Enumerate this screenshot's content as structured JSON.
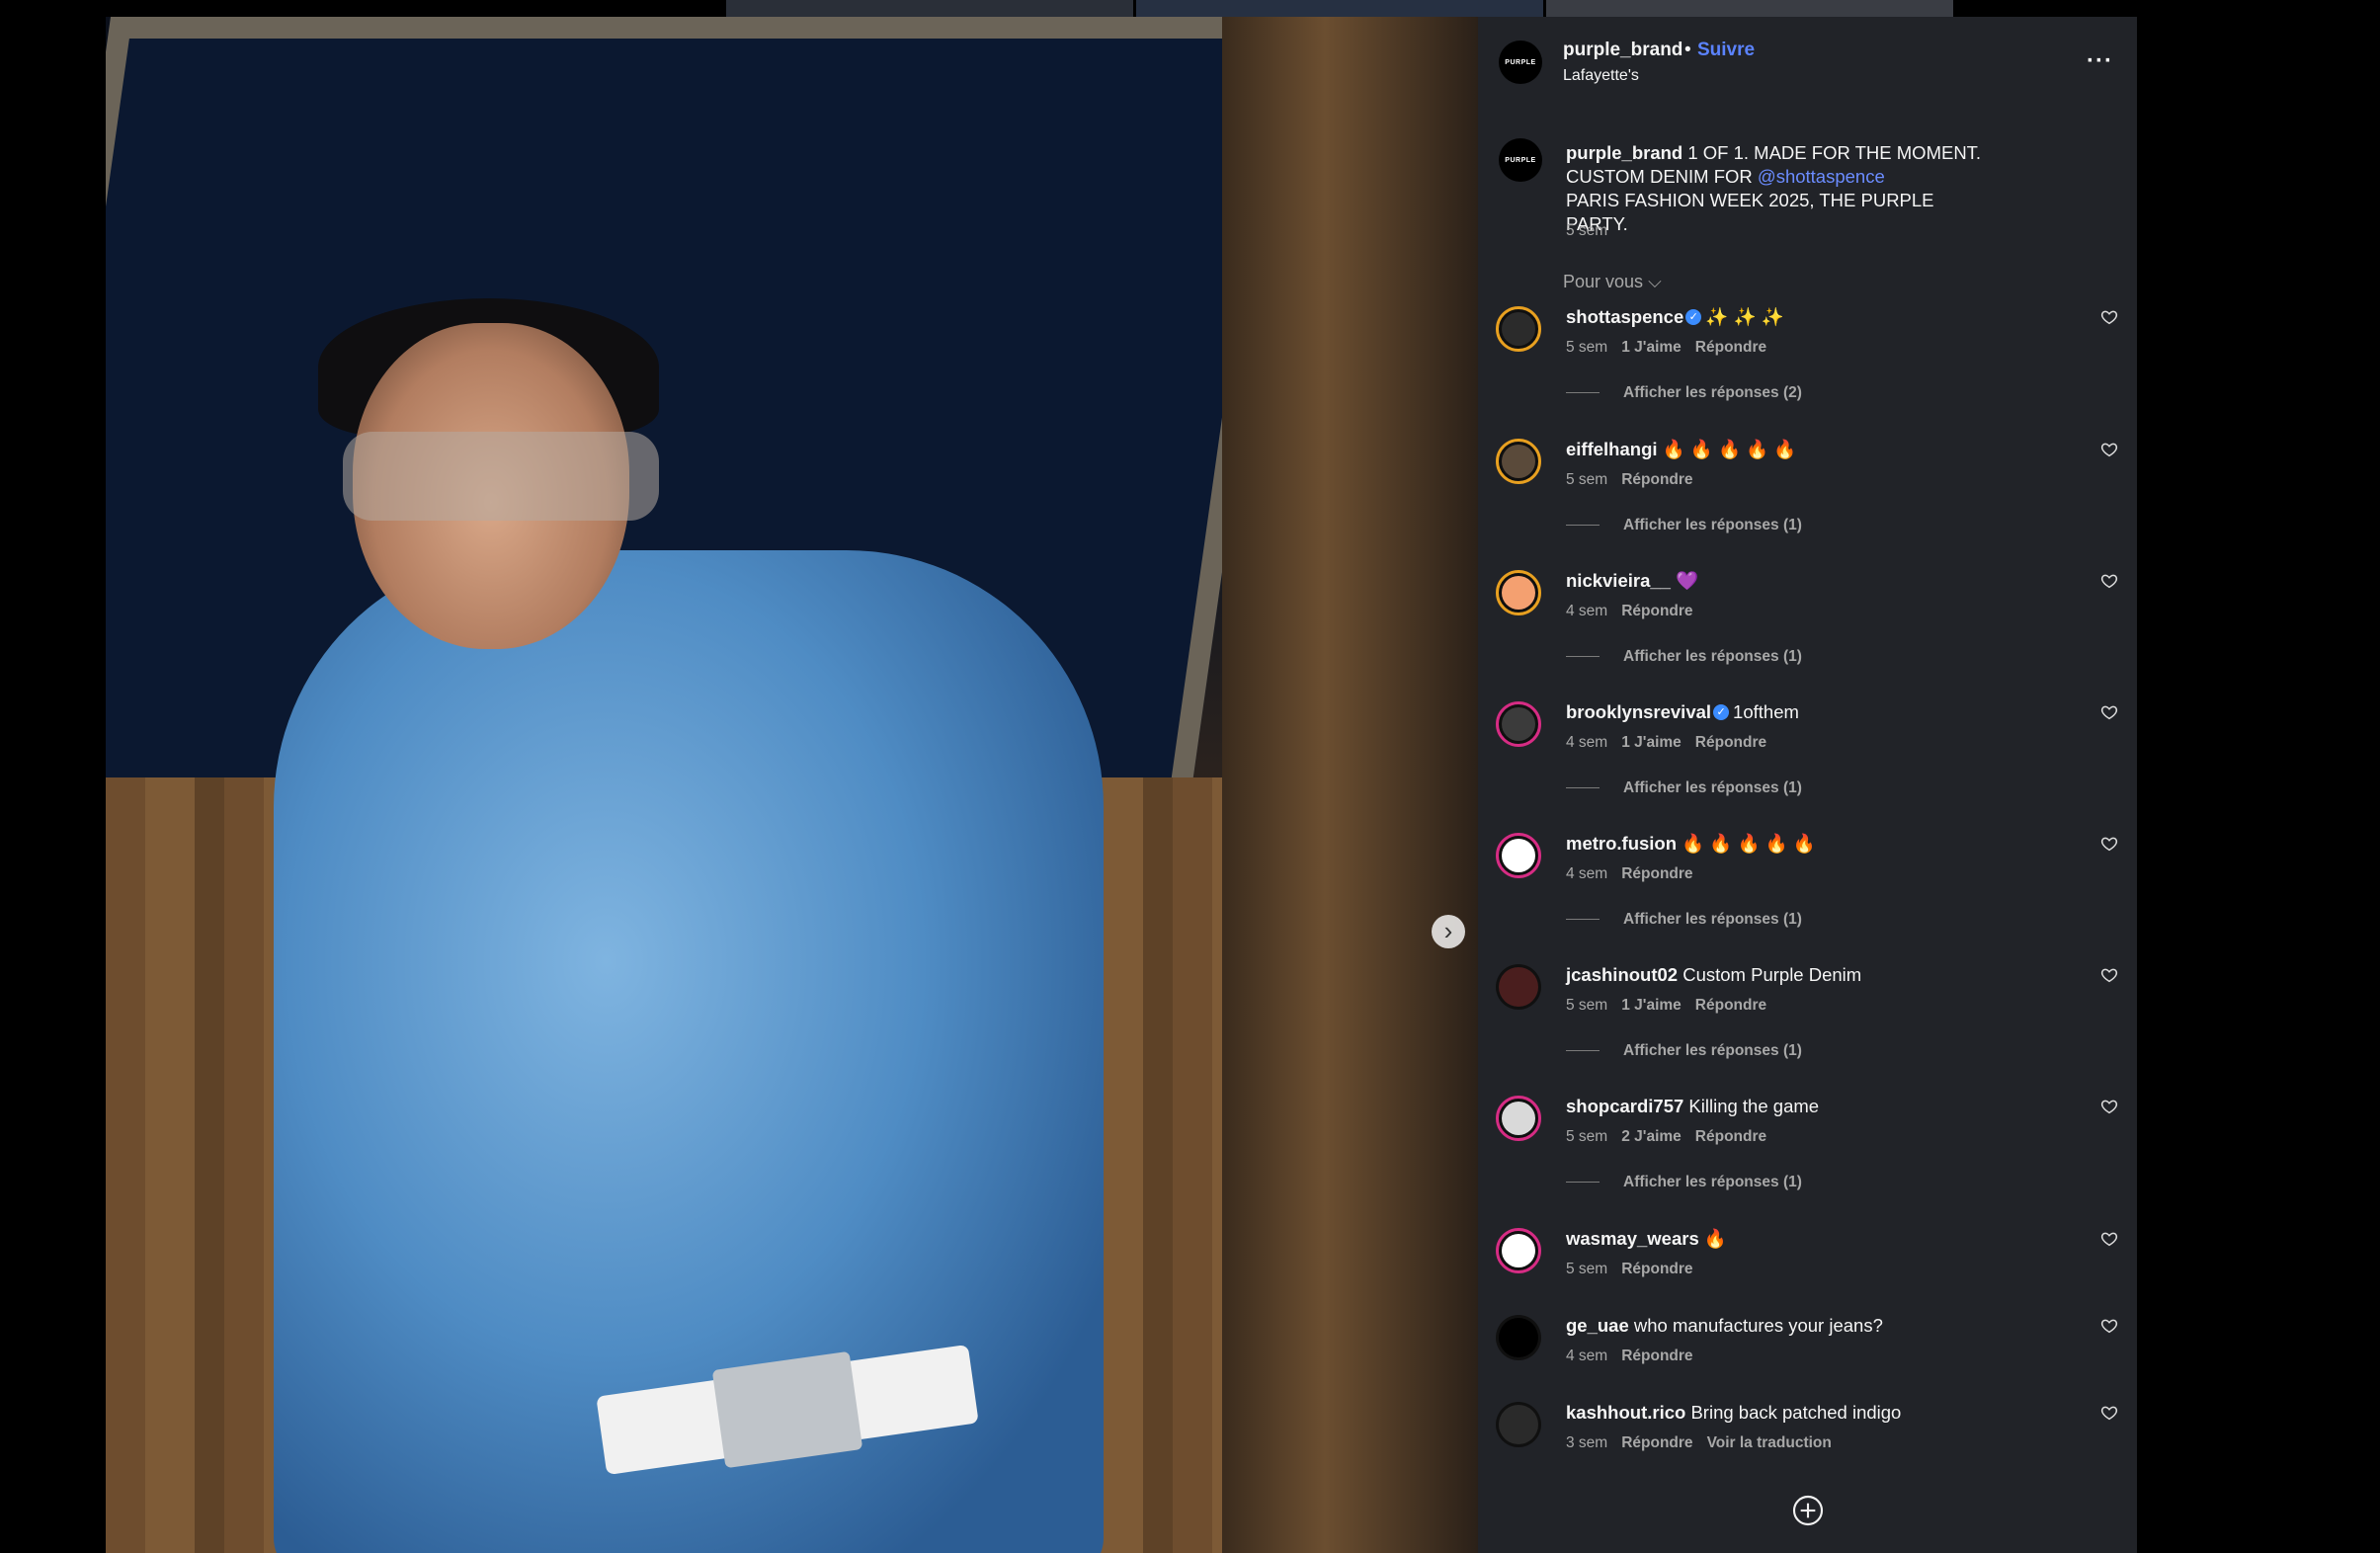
{
  "post": {
    "username": "purple_brand",
    "follow_label": "Suivre",
    "location": "Lafayette's",
    "avatar_text": "PURPLE",
    "caption_user": "purple_brand",
    "caption_line1": " 1 OF 1. MADE FOR THE MOMENT.",
    "caption_line2_prefix": "CUSTOM DENIM FOR ",
    "caption_mention": "@shottaspence",
    "caption_line3": "PARIS FASHION WEEK 2025, THE PURPLE PARTY.",
    "caption_time": "5 sem",
    "filter_label": "Pour vous"
  },
  "comments": [
    {
      "user": "shottaspence",
      "verified": true,
      "text": "✨ ✨ ✨",
      "time": "5 sem",
      "likes": "1 J'aime",
      "reply": "Répondre",
      "replies": "Afficher les réponses (2)",
      "ring": "orange",
      "avatar_color": "#2b2b2b"
    },
    {
      "user": "eiffelhangi",
      "verified": false,
      "text": "🔥 🔥 🔥 🔥 🔥",
      "time": "5 sem",
      "likes": "",
      "reply": "Répondre",
      "replies": "Afficher les réponses (1)",
      "ring": "orange",
      "avatar_color": "#5a4a3a"
    },
    {
      "user": "nickvieira__",
      "verified": false,
      "text": "💜",
      "time": "4 sem",
      "likes": "",
      "reply": "Répondre",
      "replies": "Afficher les réponses (1)",
      "ring": "orange",
      "avatar_color": "#f4a070"
    },
    {
      "user": "brooklynsrevival",
      "verified": true,
      "text": "1ofthem",
      "time": "4 sem",
      "likes": "1 J'aime",
      "reply": "Répondre",
      "replies": "Afficher les réponses (1)",
      "ring": "pink",
      "avatar_color": "#3b3b3b"
    },
    {
      "user": "metro.fusion",
      "verified": false,
      "text": "🔥 🔥 🔥 🔥 🔥",
      "time": "4 sem",
      "likes": "",
      "reply": "Répondre",
      "replies": "Afficher les réponses (1)",
      "ring": "pink",
      "avatar_color": "#ffffff"
    },
    {
      "user": "jcashinout02",
      "verified": false,
      "text": "Custom Purple Denim",
      "time": "5 sem",
      "likes": "1 J'aime",
      "reply": "Répondre",
      "replies": "Afficher les réponses (1)",
      "ring": "none",
      "avatar_color": "#4a1e1e"
    },
    {
      "user": "shopcardi757",
      "verified": false,
      "text": "Killing the game",
      "time": "5 sem",
      "likes": "2 J'aime",
      "reply": "Répondre",
      "replies": "Afficher les réponses (1)",
      "ring": "pink",
      "avatar_color": "#d9d9d9"
    },
    {
      "user": "wasmay_wears",
      "verified": false,
      "text": "🔥",
      "time": "5 sem",
      "likes": "",
      "reply": "Répondre",
      "replies": "",
      "ring": "pink",
      "avatar_color": "#ffffff"
    },
    {
      "user": "ge_uae",
      "verified": false,
      "text": "who manufactures your jeans?",
      "time": "4 sem",
      "likes": "",
      "reply": "Répondre",
      "replies": "",
      "ring": "none",
      "avatar_color": "#000000"
    },
    {
      "user": "kashhout.rico",
      "verified": false,
      "text": "Bring back patched indigo",
      "time": "3 sem",
      "likes": "",
      "reply": "Répondre",
      "replies": "",
      "translate": "Voir la traduction",
      "ring": "none",
      "avatar_color": "#2a2a2a"
    }
  ]
}
